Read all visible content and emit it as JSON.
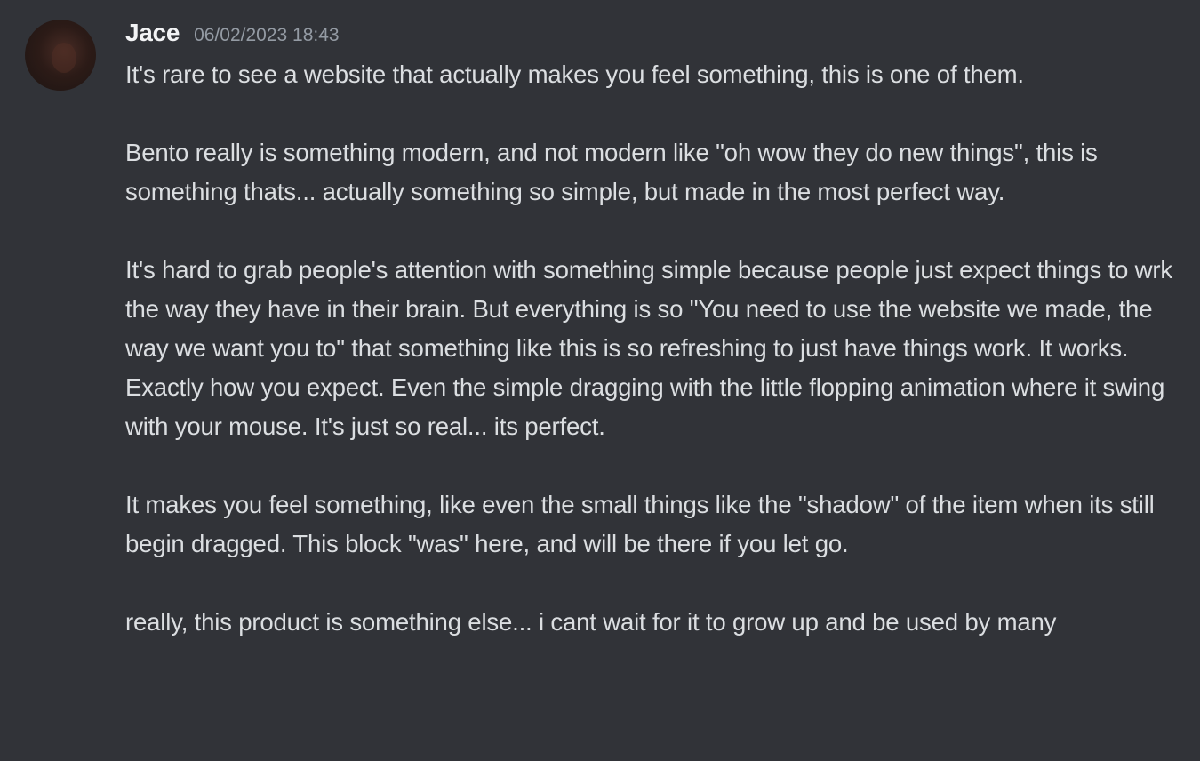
{
  "message": {
    "author": "Jace",
    "timestamp": "06/02/2023 18:43",
    "paragraphs": [
      "It's rare to see a website that actually makes you feel something, this is one of them.",
      "Bento really is something modern, and not modern like \"oh wow they do new things\", this is something thats... actually something so simple, but made in the most perfect way.",
      "It's hard to grab people's attention with something simple because people just expect things to wrk the way they have in their brain. But everything is so \"You need to use the website we made, the way we want you to\" that something like this is so refreshing to just have things work. It works. Exactly how you expect. Even the simple dragging with the little flopping animation where it swing with your mouse. It's just so real... its perfect.",
      "It makes you feel something, like even the small things like the \"shadow\" of the item when its still begin dragged. This block \"was\" here, and will be there if you let go.",
      "really, this product is something else... i cant wait for it to grow up and be used by many"
    ]
  },
  "colors": {
    "background": "#313338",
    "author": "#f2f3f5",
    "timestamp": "#949ba4",
    "text": "#dbdee1"
  }
}
